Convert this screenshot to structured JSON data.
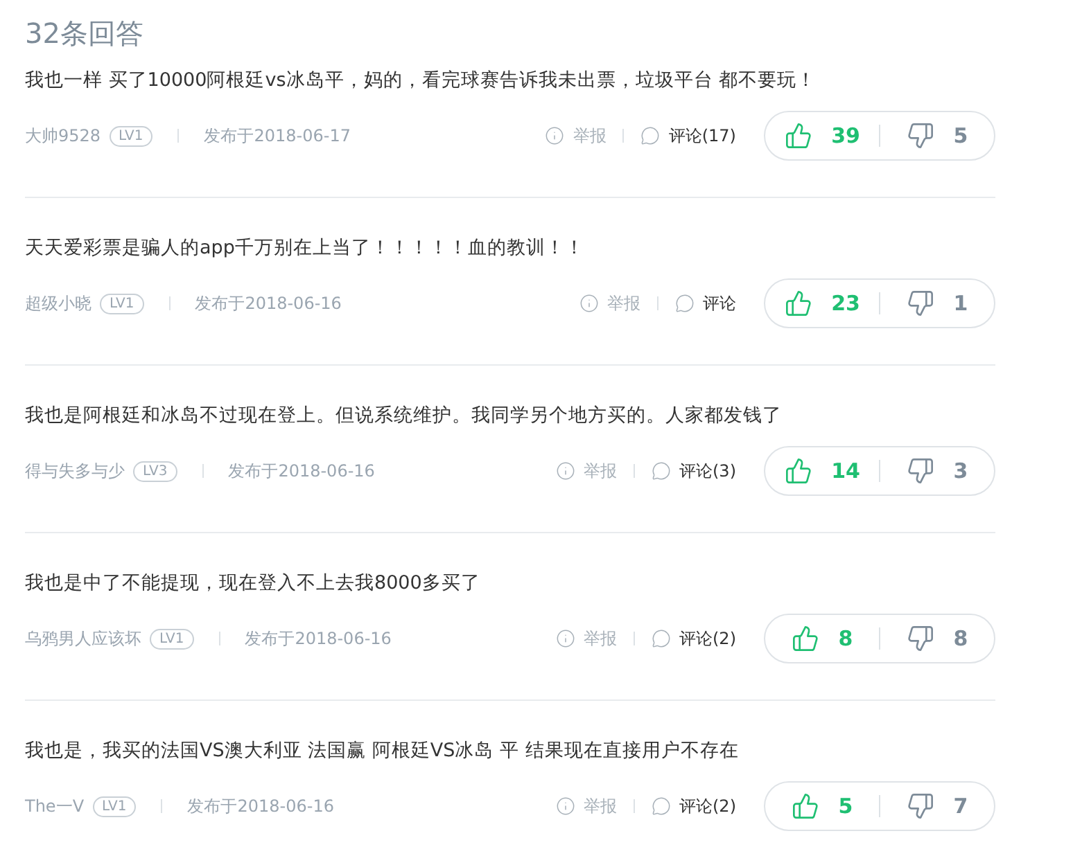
{
  "title": "32条回答",
  "answers": [
    {
      "text": "我也一样 买了10000阿根廷vs冰岛平，妈的，看完球赛告诉我未出票，垃圾平台 都不要玩！",
      "user": "大帅9528",
      "level": "LV1",
      "date": "发布于2018-06-17",
      "report": "举报",
      "comment": "评论(17)",
      "up": "39",
      "down": "5"
    },
    {
      "text": "天天爱彩票是骗人的app千万别在上当了！！！！！血的教训！！",
      "user": "超级小晓",
      "level": "LV1",
      "date": "发布于2018-06-16",
      "report": "举报",
      "comment": "评论",
      "up": "23",
      "down": "1"
    },
    {
      "text": "我也是阿根廷和冰岛不过现在登上。但说系统维护。我同学另个地方买的。人家都发钱了",
      "user": "得与失多与少",
      "level": "LV3",
      "date": "发布于2018-06-16",
      "report": "举报",
      "comment": "评论(3)",
      "up": "14",
      "down": "3"
    },
    {
      "text": "我也是中了不能提现，现在登入不上去我8000多买了",
      "user": "乌鸦男人应该坏",
      "level": "LV1",
      "date": "发布于2018-06-16",
      "report": "举报",
      "comment": "评论(2)",
      "up": "8",
      "down": "8"
    },
    {
      "text": "我也是，我买的法国VS澳大利亚 法国赢 阿根廷VS冰岛 平 结果现在直接用户不存在",
      "user": "The一V",
      "level": "LV1",
      "date": "发布于2018-06-16",
      "report": "举报",
      "comment": "评论(2)",
      "up": "5",
      "down": "7"
    }
  ]
}
